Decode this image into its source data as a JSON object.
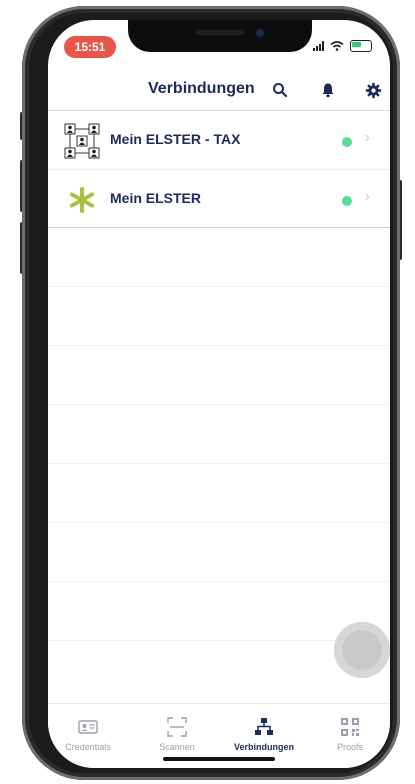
{
  "status_bar": {
    "time": "15:51",
    "time_color": "#e8564a"
  },
  "header": {
    "title": "Verbindungen",
    "icons": [
      "search-icon",
      "bell-icon",
      "gear-icon"
    ],
    "accent": "#1e2a5a"
  },
  "connections": [
    {
      "label": "Mein ELSTER - TAX",
      "icon": "network-people-icon",
      "status_color": "#55dd9a"
    },
    {
      "label": "Mein ELSTER",
      "icon": "asterisk-icon",
      "status_color": "#55dd9a"
    }
  ],
  "tabbar": {
    "tabs": [
      {
        "label": "Credentials",
        "icon": "id-card-icon",
        "active": false
      },
      {
        "label": "Scannen",
        "icon": "scan-frame-icon",
        "active": false
      },
      {
        "label": "Verbindungen",
        "icon": "network-icon",
        "active": true
      },
      {
        "label": "Proofs",
        "icon": "qr-code-icon",
        "active": false
      }
    ]
  }
}
